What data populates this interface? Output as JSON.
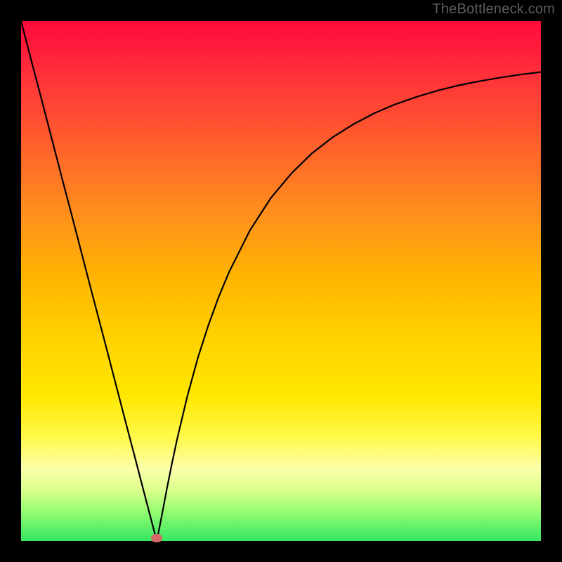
{
  "watermark": "TheBottleneck.com",
  "colors": {
    "frame": "#000000",
    "curve": "#000000",
    "dot": "#d46a6a"
  },
  "chart_data": {
    "type": "line",
    "title": "",
    "xlabel": "",
    "ylabel": "",
    "xlim": [
      0,
      100
    ],
    "ylim": [
      0,
      100
    ],
    "grid": false,
    "legend": false,
    "marker": {
      "x": 26.1,
      "y": 0.5
    },
    "series": [
      {
        "name": "curve",
        "x": [
          0,
          2,
          4,
          6,
          8,
          10,
          12,
          14,
          16,
          18,
          20,
          22,
          24,
          25,
          26.1,
          27,
          28,
          29,
          30,
          32,
          34,
          36,
          38,
          40,
          44,
          48,
          52,
          56,
          60,
          64,
          68,
          72,
          76,
          80,
          84,
          88,
          92,
          96,
          100
        ],
        "y": [
          100,
          92.3,
          84.7,
          77.0,
          69.3,
          61.7,
          54.0,
          46.3,
          38.7,
          31.0,
          23.3,
          15.7,
          8.0,
          4.2,
          0.0,
          4.5,
          9.8,
          14.8,
          19.5,
          27.9,
          35.2,
          41.4,
          46.9,
          51.7,
          59.7,
          65.9,
          70.7,
          74.6,
          77.7,
          80.2,
          82.3,
          84.0,
          85.4,
          86.6,
          87.6,
          88.4,
          89.1,
          89.7,
          90.2
        ]
      }
    ]
  }
}
